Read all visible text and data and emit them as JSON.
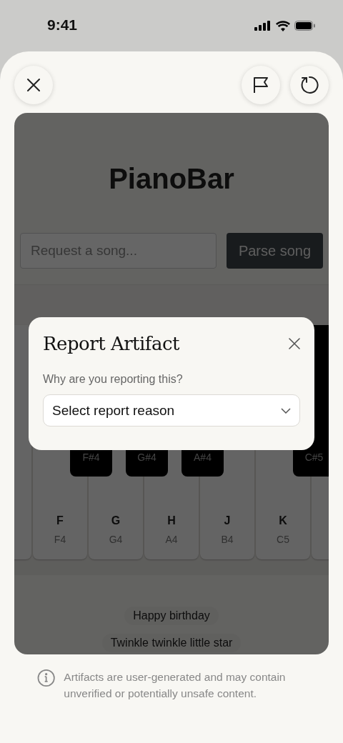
{
  "status_bar": {
    "time": "9:41"
  },
  "app": {
    "title": "PianoBar",
    "request_field": {
      "placeholder": "Request a song..."
    },
    "parse_button": "Parse song",
    "white_keys": [
      {
        "letter": "F",
        "note": "F4"
      },
      {
        "letter": "G",
        "note": "G4"
      },
      {
        "letter": "H",
        "note": "A4"
      },
      {
        "letter": "J",
        "note": "B4"
      },
      {
        "letter": "K",
        "note": "C5"
      }
    ],
    "black_keys": [
      {
        "note": "F#4"
      },
      {
        "note": "G#4"
      },
      {
        "note": "A#4"
      },
      {
        "note": "C#5"
      }
    ],
    "songs": [
      "Happy birthday",
      "Twinkle twinkle little star"
    ]
  },
  "dialog": {
    "title": "Report Artifact",
    "question": "Why are you reporting this?",
    "select": {
      "value": "Select report reason"
    }
  },
  "footer_note": "Artifacts are user-generated and may contain unverified or potentially unsafe content."
}
